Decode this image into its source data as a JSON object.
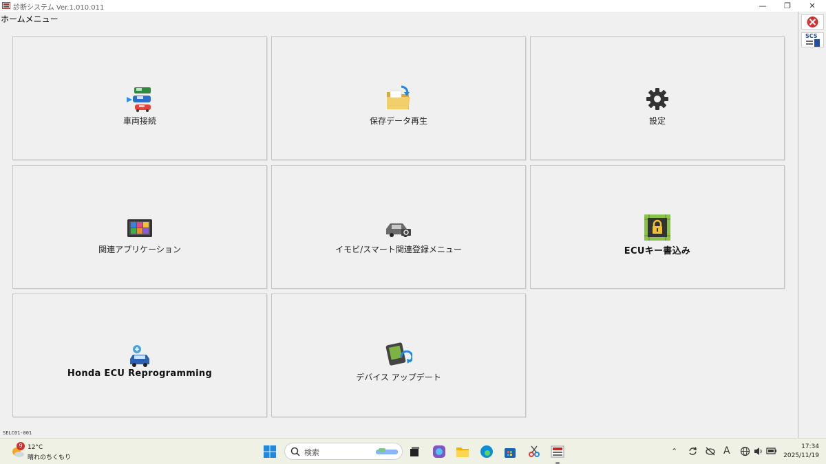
{
  "window": {
    "title": "診断システム Ver.1.010.011",
    "minimize_glyph": "—",
    "restore_glyph": "❐",
    "close_glyph": "✕"
  },
  "page": {
    "title": "ホームメニュー",
    "screen_id": "SELC01-001"
  },
  "tiles": [
    {
      "label": "車両接続",
      "icon": "vehicle-connect-icon"
    },
    {
      "label": "保存データ再生",
      "icon": "folder-icon"
    },
    {
      "label": "設定",
      "icon": "gear-icon"
    },
    {
      "label": "関連アプリケーション",
      "icon": "apps-icon"
    },
    {
      "label": "イモビ/スマート関連登録メニュー",
      "icon": "immobilizer-icon"
    },
    {
      "label": "ECUキー書込み",
      "icon": "ecu-key-icon"
    },
    {
      "label": "Honda ECU Reprogramming",
      "icon": "reprogramming-icon"
    },
    {
      "label": "デバイス アップデート",
      "icon": "device-update-icon"
    }
  ],
  "sidebar": {
    "exit_icon": "exit-icon",
    "scs_label": "SCS"
  },
  "taskbar": {
    "weather_badge": "9",
    "temperature": "12°C",
    "weather": "晴れのちくもり",
    "search_placeholder": "検索",
    "ime_glyph": "A",
    "time": "17:34",
    "date": "2025/11/19"
  }
}
